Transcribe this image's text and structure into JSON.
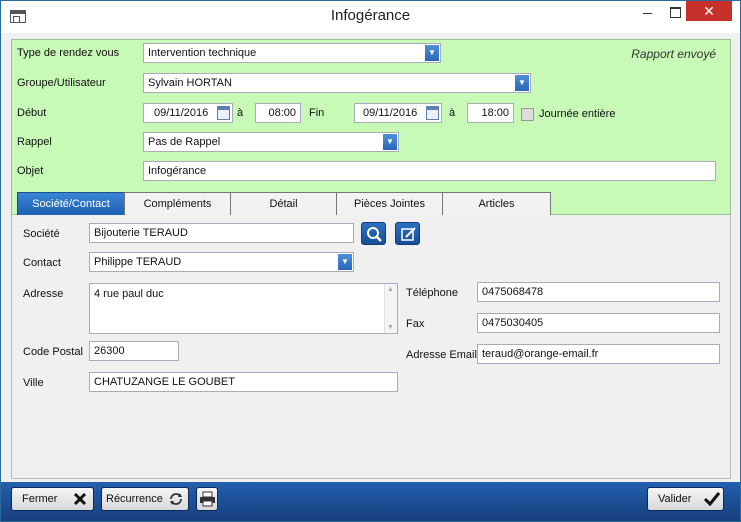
{
  "window": {
    "title": "Infogérance",
    "close_glyph": "✕"
  },
  "header": {
    "status": "Rapport envoyé",
    "type_label": "Type de rendez vous",
    "type_value": "Intervention technique",
    "group_label": "Groupe/Utilisateur",
    "group_value": "Sylvain HORTAN",
    "debut_label": "Début",
    "debut_date": "09/11/2016",
    "a_label": "à",
    "debut_time": "08:00",
    "fin_label": "Fin",
    "fin_date": "09/11/2016",
    "fin_time": "18:00",
    "allday_label": "Journée entière",
    "rappel_label": "Rappel",
    "rappel_value": "Pas de Rappel",
    "objet_label": "Objet",
    "objet_value": "Infogérance"
  },
  "tabs": [
    {
      "label": "Société/Contact",
      "active": true
    },
    {
      "label": "Compléments"
    },
    {
      "label": "Détail"
    },
    {
      "label": "Pièces Jointes"
    },
    {
      "label": "Articles"
    }
  ],
  "contact": {
    "societe_label": "Société",
    "societe_value": "Bijouterie TERAUD",
    "contact_label": "Contact",
    "contact_value": "Philippe TERAUD",
    "adresse_label": "Adresse",
    "adresse_value": "4 rue paul duc",
    "cp_label": "Code Postal",
    "cp_value": "26300",
    "ville_label": "Ville",
    "ville_value": "CHATUZANGE LE GOUBET",
    "tel_label": "Téléphone",
    "tel_value": "0475068478",
    "fax_label": "Fax",
    "fax_value": "0475030405",
    "email_label": "Adresse Email",
    "email_value": "teraud@orange-email.fr"
  },
  "footer": {
    "fermer": "Fermer",
    "recurrence": "Récurrence",
    "valider": "Valider"
  },
  "colors": {
    "header_bg": "#c7fab6",
    "footer_bg": "#1f56a0",
    "accent": "#2a66b8"
  }
}
